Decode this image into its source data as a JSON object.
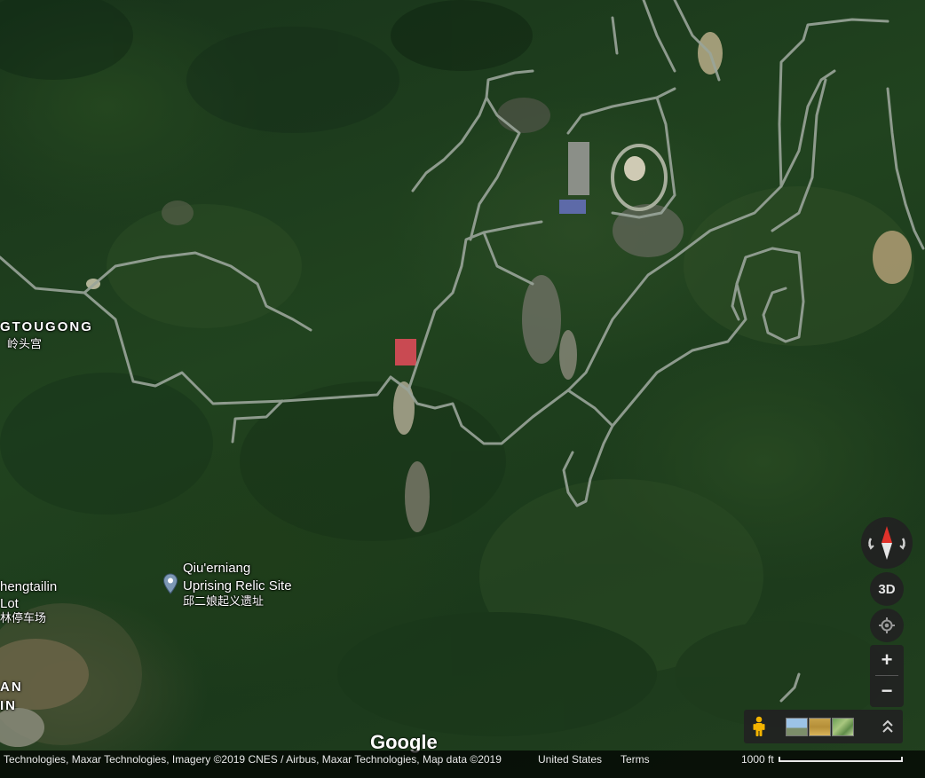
{
  "map": {
    "labels": {
      "town_top_left": "GTOUGONG",
      "town_top_left_cn": "岭头宫",
      "poi_name_line1": "Qiu'erniang",
      "poi_name_line2": "Uprising Relic Site",
      "poi_name_cn": "邱二娘起义遗址",
      "left_place_line1": "hengtailin",
      "left_place_line2": "Lot",
      "left_place_cn": "林停车场",
      "left_bottom_line1": "AN",
      "left_bottom_line2": "IN"
    },
    "poi_icon": "map-pin-icon"
  },
  "branding": {
    "logo": "Google"
  },
  "footer": {
    "attribution": "Technologies, Maxar Technologies, Imagery ©2019 CNES / Airbus, Maxar Technologies, Map data ©2019",
    "region": "United States",
    "terms": "Terms",
    "scale_label": "1000 ft"
  },
  "controls": {
    "compass_icon": "compass-icon",
    "three_d_label": "3D",
    "locate_icon": "my-location-icon",
    "zoom_in_label": "+",
    "zoom_out_label": "−",
    "pegman_icon": "pegman-icon",
    "layer_icons": [
      "street-view-thumbnail",
      "imagery-thumbnail",
      "terrain-thumbnail"
    ],
    "expand_icon": "chevron-double-up-icon"
  },
  "colors": {
    "forest": "#1f3d1c",
    "road": "#9aa59a",
    "control_bg": "#222222",
    "compass_north": "#e0322b"
  }
}
